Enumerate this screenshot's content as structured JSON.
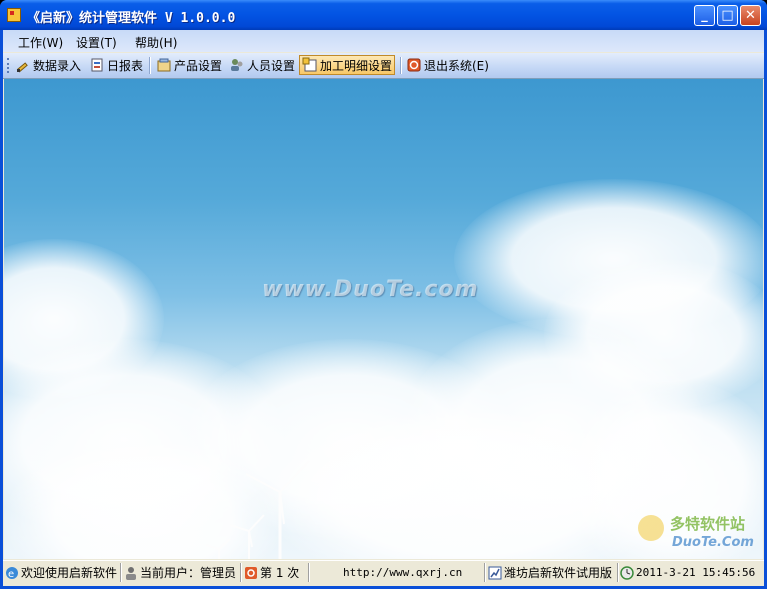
{
  "window": {
    "title": "《启新》统计管理软件 V 1.0.0.0"
  },
  "window_buttons": {
    "minimize": "_",
    "maximize": "□",
    "close": "✕"
  },
  "menu": [
    {
      "label": "工作(W)"
    },
    {
      "label": "设置(T)"
    },
    {
      "label": "帮助(H)"
    }
  ],
  "toolbar": [
    {
      "label": "数据录入",
      "icon": "pencil-icon"
    },
    {
      "label": "日报表",
      "icon": "report-icon"
    },
    {
      "label": "产品设置",
      "icon": "product-settings-icon"
    },
    {
      "label": "人员设置",
      "icon": "people-icon"
    },
    {
      "label": "加工明细设置",
      "icon": "process-detail-icon"
    },
    {
      "label": "退出系统(E)",
      "icon": "exit-icon"
    }
  ],
  "content": {
    "watermark": "www.DuoTe.com",
    "corner_logo": "多特软件站",
    "corner_logo_sub": "DuoTe.Com"
  },
  "status": {
    "welcome": "欢迎使用启新软件",
    "user": "当前用户：管理员",
    "count": "第 1 次",
    "url": "http://www.qxrj.cn",
    "edition": "潍坊启新软件试用版",
    "datetime": "2011-3-21 15:45:56"
  },
  "colors": {
    "title_bar": "#0354e3",
    "toolbar_active": "#f8c867",
    "sky_top": "#3d98d0"
  }
}
